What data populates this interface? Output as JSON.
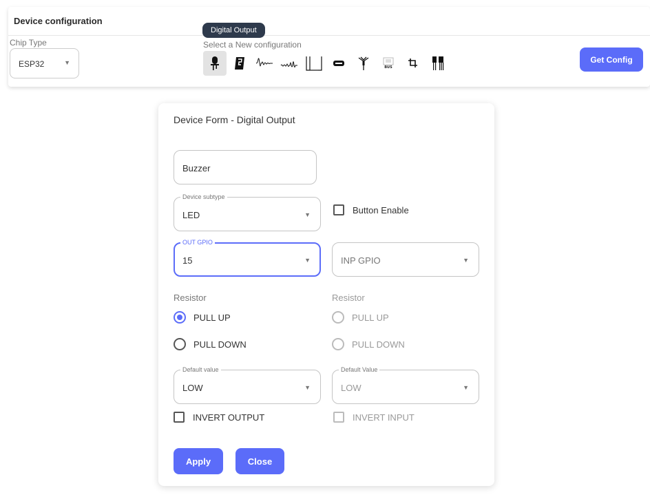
{
  "header": {
    "title": "Device configuration"
  },
  "chip": {
    "label": "Chip Type",
    "value": "ESP32"
  },
  "configs": {
    "label": "Select a New configuration",
    "tooltip": "Digital Output",
    "icons": [
      "digital-output-icon",
      "display-icon",
      "analog-wave-icon",
      "pwm-wave-icon",
      "pulse-icon",
      "led-strip-icon",
      "antenna-icon",
      "bus-icon",
      "i2c-icon",
      "multi-pin-icon"
    ]
  },
  "toolbar": {
    "get_config_label": "Get Config"
  },
  "form": {
    "title": "Device Form - Digital Output",
    "name_value": "Buzzer",
    "subtype_label": "Device subtype",
    "subtype_value": "LED",
    "button_enable_label": "Button Enable",
    "out_gpio_label": "OUT GPIO",
    "out_gpio_value": "15",
    "inp_gpio_placeholder": "INP GPIO",
    "left_resistor": {
      "label": "Resistor",
      "pull_up": "PULL UP",
      "pull_down": "PULL DOWN",
      "selected": "PULL UP"
    },
    "right_resistor": {
      "label": "Resistor",
      "pull_up": "PULL UP",
      "pull_down": "PULL DOWN"
    },
    "default_value_label": "Default value",
    "default_value": "LOW",
    "default_value_right_label": "Default Value",
    "default_value_right": "LOW",
    "invert_output_label": "INVERT OUTPUT",
    "invert_input_label": "INVERT INPUT",
    "apply_label": "Apply",
    "close_label": "Close"
  },
  "colors": {
    "accent": "#5b6cf9",
    "tooltip_bg": "#2e3a4c"
  }
}
